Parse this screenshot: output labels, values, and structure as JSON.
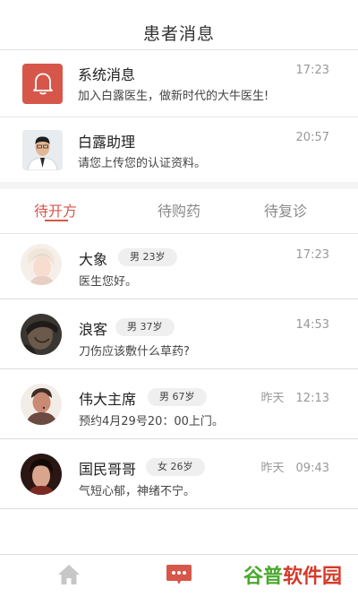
{
  "header": {
    "title": "患者消息"
  },
  "system_messages": [
    {
      "name": "系统消息",
      "text": "加入白露医生，做新时代的大牛医生!",
      "time": "17:23",
      "icon": "bell-icon"
    },
    {
      "name": "白露助理",
      "text": "请您上传您的认证资料。",
      "time": "20:57",
      "icon": "assistant-avatar"
    }
  ],
  "tabs": [
    {
      "label": "待开方",
      "active": true
    },
    {
      "label": "待购药",
      "active": false
    },
    {
      "label": "待复诊",
      "active": false
    }
  ],
  "patients": [
    {
      "name": "大象",
      "badge": "男 23岁",
      "message": "医生您好。",
      "time": "17:23"
    },
    {
      "name": "浪客",
      "badge": "男 37岁",
      "message": "刀伤应该敷什么草药?",
      "time": "14:53"
    },
    {
      "name": "伟大主席",
      "badge": "男 67岁",
      "message": "预约4月29号20：00上门。",
      "time": "昨天　12:13"
    },
    {
      "name": "国民哥哥",
      "badge": "女 26岁",
      "message": "气短心郁，神绪不宁。",
      "time": "昨天　09:43"
    }
  ],
  "bottom_nav": [
    {
      "name": "home-icon",
      "active": false
    },
    {
      "name": "chat-icon",
      "active": true
    }
  ],
  "watermark": {
    "part1": "谷普",
    "part2": "软件园"
  },
  "colors": {
    "accent": "#d6574a",
    "watermark_green": "#4aa82e",
    "watermark_red": "#d63a2a"
  }
}
